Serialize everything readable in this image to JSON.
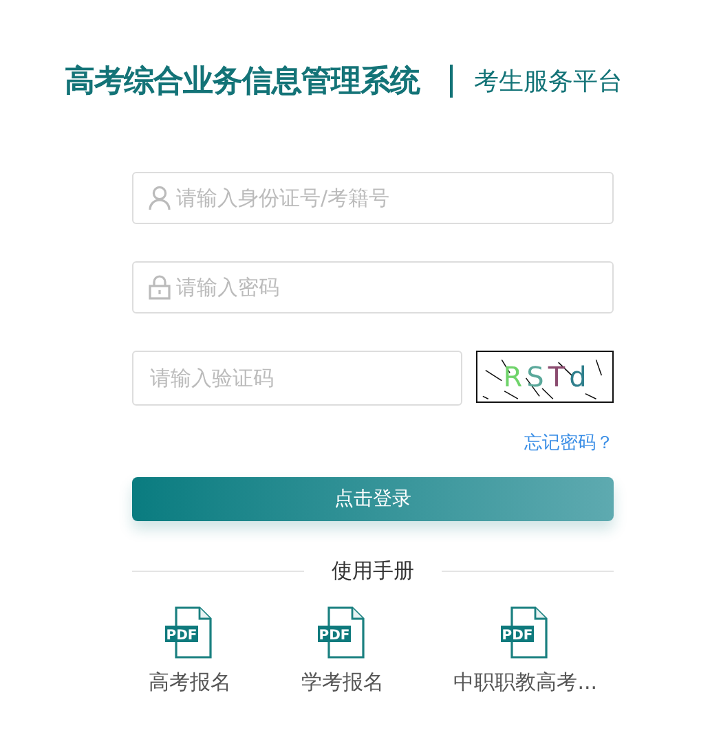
{
  "header": {
    "title": "高考综合业务信息管理系统",
    "subtitle": "考生服务平台"
  },
  "fields": [
    {
      "kind": "user",
      "placeholder": "请输入身份证号/考籍号"
    },
    {
      "kind": "lock",
      "placeholder": "请输入密码"
    }
  ],
  "captcha": {
    "placeholder": "请输入验证码",
    "chars": [
      {
        "char": "R",
        "color": "#6fd36a"
      },
      {
        "char": "S",
        "color": "#5aa89a"
      },
      {
        "char": "T",
        "color": "#8a4a6e"
      },
      {
        "char": "d",
        "color": "#2f7f8c"
      }
    ]
  },
  "forgot_link": "忘记密码？",
  "login_button": "点击登录",
  "manuals": {
    "heading": "使用手册",
    "items": [
      {
        "badge": "PDF",
        "label": "高考报名"
      },
      {
        "badge": "PDF",
        "label": "学考报名"
      },
      {
        "badge": "PDF",
        "label": "中职职教高考..."
      }
    ]
  }
}
